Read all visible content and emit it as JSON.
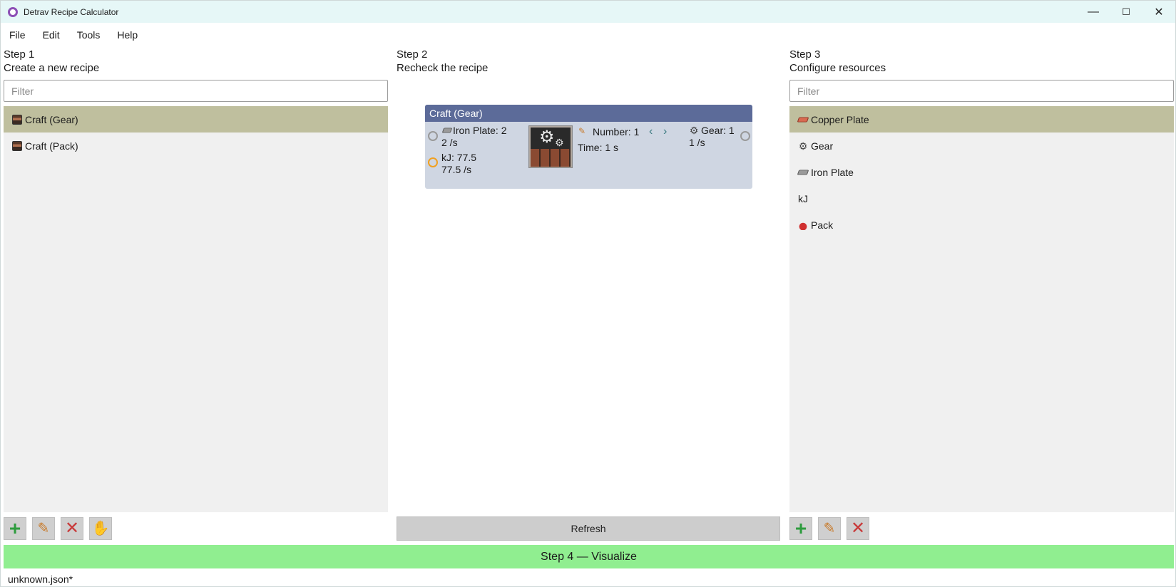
{
  "window": {
    "title": "Detrav Recipe Calculator",
    "controls": {
      "minimize": "—",
      "maximize": "☐",
      "close": "✕"
    }
  },
  "menu": [
    "File",
    "Edit",
    "Tools",
    "Help"
  ],
  "step1": {
    "label": "Step 1",
    "subtitle": "Create a new recipe",
    "filter_placeholder": "Filter",
    "items": [
      {
        "label": "Craft (Gear)",
        "icon": "assembler-icon",
        "selected": true
      },
      {
        "label": "Craft (Pack)",
        "icon": "assembler-icon",
        "selected": false
      }
    ]
  },
  "step2": {
    "label": "Step 2",
    "subtitle": "Recheck the recipe",
    "card": {
      "title": "Craft (Gear)",
      "inputs": [
        {
          "name": "Iron Plate: 2",
          "rate": "2 /s",
          "icon": "iron-plate-icon"
        },
        {
          "name": "kJ: 77.5",
          "rate": "77.5 /s",
          "icon": "energy-icon"
        }
      ],
      "number_label": "Number: 1",
      "time_label": "Time:  1 s",
      "output": {
        "name": "Gear: 1",
        "rate": "1 /s",
        "icon": "gear-icon"
      }
    },
    "refresh_label": "Refresh"
  },
  "step3": {
    "label": "Step 3",
    "subtitle": "Configure resources",
    "filter_placeholder": "Filter",
    "items": [
      {
        "label": "Copper Plate",
        "icon": "copper-plate-icon",
        "selected": true
      },
      {
        "label": "Gear",
        "icon": "gear-icon",
        "selected": false
      },
      {
        "label": "Iron Plate",
        "icon": "iron-plate-icon",
        "selected": false
      },
      {
        "label": "kJ",
        "icon": "",
        "selected": false
      },
      {
        "label": "Pack",
        "icon": "pack-icon",
        "selected": false
      }
    ]
  },
  "step4_label": "Step 4 — Visualize",
  "status": "unknown.json*",
  "colors": {
    "title_bar": "#e6f7f7",
    "selected_item": "#bfbf9e",
    "card_header": "#5c6b99",
    "card_body": "#cfd6e2",
    "visualize_button": "#90ee90"
  }
}
